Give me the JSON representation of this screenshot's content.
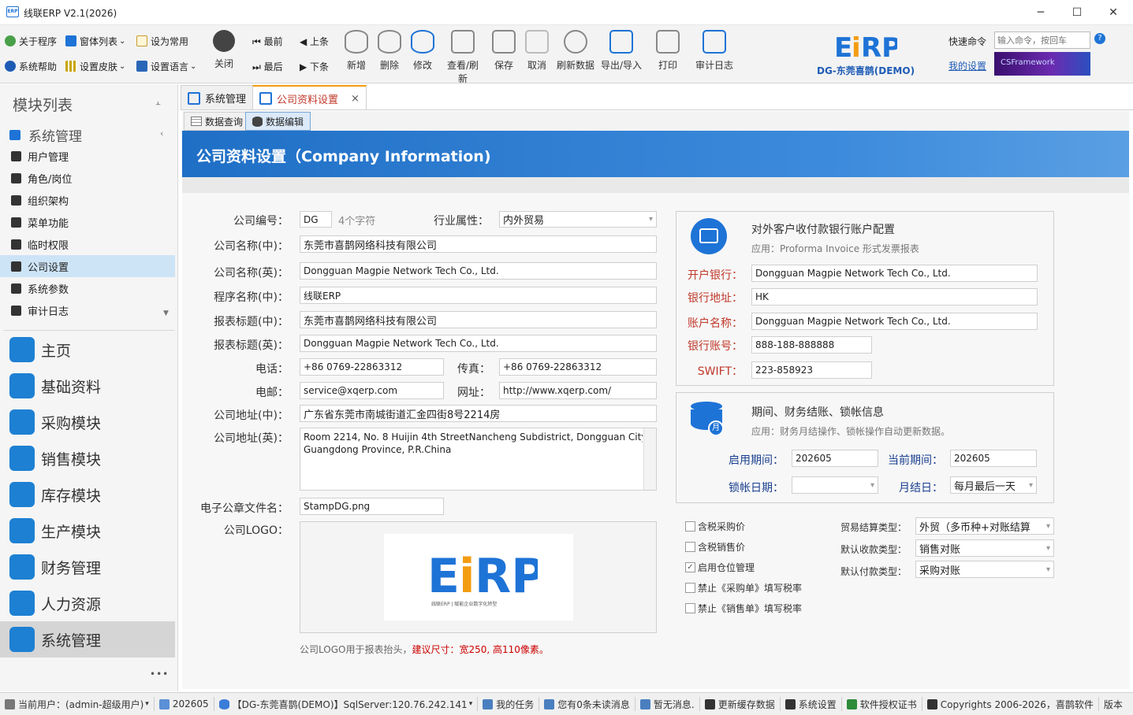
{
  "window": {
    "title": "线联ERP V2.1(2026)",
    "logo_text": "ERP",
    "min": "─",
    "max": "☐",
    "close": "✕"
  },
  "ribbon": {
    "left": [
      {
        "label": "关于程序",
        "icon": "globe-icon"
      },
      {
        "label": "窗体列表",
        "icon": "windows-icon",
        "caret": "⌄"
      },
      {
        "label": "设为常用",
        "icon": "clipboard-icon"
      },
      {
        "label": "系统帮助",
        "icon": "help-icon"
      },
      {
        "label": "设置皮肤",
        "icon": "grid-icon",
        "caret": "⌄"
      },
      {
        "label": "设置语言",
        "icon": "language-icon",
        "caret": "⌄"
      }
    ],
    "close_label": "关闭",
    "nav": {
      "first": "最前",
      "prev": "上条",
      "last": "最后",
      "next": "下条"
    },
    "buttons": [
      {
        "label": "新增",
        "icon": "database-add-icon"
      },
      {
        "label": "删除",
        "icon": "database-delete-icon"
      },
      {
        "label": "修改",
        "icon": "database-edit-icon"
      },
      {
        "label": "查看/刷新",
        "icon": "view-refresh-icon"
      },
      {
        "label": "保存",
        "icon": "save-icon"
      },
      {
        "label": "取消",
        "icon": "cancel-icon"
      },
      {
        "label": "刷新数据",
        "icon": "refresh-icon"
      },
      {
        "label": "导出/导入",
        "icon": "export-icon"
      },
      {
        "label": "打印",
        "icon": "print-icon"
      },
      {
        "label": "审计日志",
        "icon": "audit-log-icon"
      }
    ],
    "company": "DG-东莞喜鹊(DEMO)",
    "quick_cmd_label": "快速命令",
    "quick_cmd_placeholder": "输入命令，按回车",
    "my_settings": "我的设置",
    "framework": "CSFramework"
  },
  "sidebar": {
    "title": "模块列表",
    "pin": "⫠",
    "group": "系统管理",
    "items": [
      "用户管理",
      "角色/岗位",
      "组织架构",
      "菜单功能",
      "临时权限",
      "公司设置",
      "系统参数",
      "审计日志"
    ],
    "active_index": 5,
    "modules": [
      {
        "label": "主页",
        "color": "#1d80d3"
      },
      {
        "label": "基础资料",
        "color": "#1d80d3"
      },
      {
        "label": "采购模块",
        "color": "#1d80d3"
      },
      {
        "label": "销售模块",
        "color": "#1d80d3"
      },
      {
        "label": "库存模块",
        "color": "#1d80d3"
      },
      {
        "label": "生产模块",
        "color": "#1d80d3"
      },
      {
        "label": "财务管理",
        "color": "#1d80d3"
      },
      {
        "label": "人力资源",
        "color": "#1d80d3"
      },
      {
        "label": "系统管理",
        "color": "#1d80d3"
      }
    ],
    "more": "•••"
  },
  "tabs": {
    "doc": [
      "系统管理",
      "公司资料设置"
    ],
    "close": "×",
    "sub": [
      "数据查询",
      "数据编辑"
    ]
  },
  "banner": "公司资料设置（Company Information)",
  "form": {
    "code_label": "公司编号：",
    "code": "DG",
    "code_hint": "4个字符",
    "industry_label": "行业属性：",
    "industry": "内外贸易",
    "name_cn_label": "公司名称(中)：",
    "name_cn": "东莞市喜鹊网络科技有限公司",
    "name_en_label": "公司名称(英)：",
    "name_en": "Dongguan Magpie Network Tech Co., Ltd.",
    "app_cn_label": "程序名称(中)：",
    "app_cn": "线联ERP",
    "rpt_cn_label": "报表标题(中)：",
    "rpt_cn": "东莞市喜鹊网络科技有限公司",
    "rpt_en_label": "报表标题(英)：",
    "rpt_en": "Dongguan Magpie Network Tech Co., Ltd.",
    "tel_label": "电话：",
    "tel": "+86 0769-22863312",
    "fax_label": "传真：",
    "fax": "+86 0769-22863312",
    "email_label": "电邮：",
    "email": "service@xqerp.com",
    "web_label": "网址：",
    "web": "http://www.xqerp.com/",
    "addr_cn_label": "公司地址(中)：",
    "addr_cn": "广东省东莞市南城街道汇金四街8号2214房",
    "addr_en_label": "公司地址(英)：",
    "addr_en_1": "Room 2214, No. 8 Huijin 4th StreetNancheng Subdistrict, Dongguan City",
    "addr_en_2": "Guangdong Province, P.R.China",
    "stamp_label": "电子公章文件名：",
    "stamp": "StampDG.png",
    "logo_label": "公司LOGO：",
    "logo_caption": "线联ERP | 赋能企业数字化转型",
    "logo_note": "公司LOGO用于报表抬头，",
    "logo_note_red": "建议尺寸：宽250, 高110像素。"
  },
  "bank": {
    "title": "对外客户收付款银行账户配置",
    "subtitle": "应用：Proforma Invoice 形式发票报表",
    "bank_label": "开户银行：",
    "bank": "Dongguan Magpie Network Tech Co., Ltd.",
    "addr_label": "银行地址：",
    "addr": "HK",
    "acct_name_label": "账户名称：",
    "acct_name": "Dongguan Magpie Network Tech Co., Ltd.",
    "acct_no_label": "银行账号：",
    "acct_no": "888-188-888888",
    "swift_label": "SWIFT：",
    "swift": "223-858923"
  },
  "period": {
    "title": "期间、财务结账、锁帐信息",
    "subtitle": "应用：财务月结操作、锁帐操作自动更新数据。",
    "badge": "月",
    "start_label": "启用期间：",
    "start": "202605",
    "current_label": "当前期间：",
    "current": "202605",
    "lock_label": "锁帐日期：",
    "lock": "",
    "month_end_label": "月结日：",
    "month_end": "每月最后一天"
  },
  "options": {
    "checks": [
      {
        "label": "含税采购价",
        "checked": false
      },
      {
        "label": "含税销售价",
        "checked": false
      },
      {
        "label": "启用仓位管理",
        "checked": true
      },
      {
        "label": "禁止《采购单》填写税率",
        "checked": false
      },
      {
        "label": "禁止《销售单》填写税率",
        "checked": false
      }
    ],
    "trade_label": "贸易结算类型：",
    "trade": "外贸（多币种+对账结算",
    "recv_label": "默认收款类型：",
    "recv": "销售对账",
    "pay_label": "默认付款类型：",
    "pay": "采购对账"
  },
  "status": {
    "user": "当前用户：(admin-超级用户)",
    "period": "202605",
    "db": "【DG-东莞喜鹊(DEMO)】SqlServer:120.76.242.141",
    "tasks": "我的任务",
    "msgs": "您有0条未读消息",
    "notice": "暂无消息.",
    "cache": "更新缓存数据",
    "settings": "系统设置",
    "license": "软件授权证书",
    "copyright": "Copyrights 2006-2026，喜鹊软件",
    "version": "版本"
  }
}
